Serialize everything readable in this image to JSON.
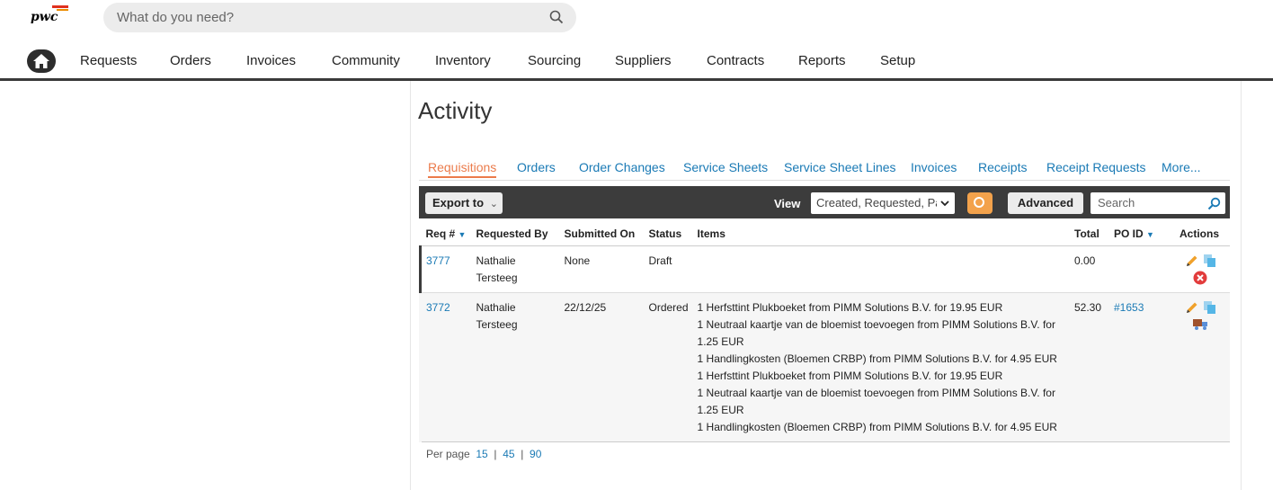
{
  "header": {
    "logo_text": "pwc",
    "search_placeholder": "What do you need?"
  },
  "nav": {
    "items": [
      "Requests",
      "Orders",
      "Invoices",
      "Community",
      "Inventory",
      "Sourcing",
      "Suppliers",
      "Contracts",
      "Reports",
      "Setup"
    ]
  },
  "page": {
    "title": "Activity"
  },
  "tabs": [
    "Requisitions",
    "Orders",
    "Order Changes",
    "Service Sheets",
    "Service Sheet Lines",
    "Invoices",
    "Receipts",
    "Receipt Requests",
    "More..."
  ],
  "toolbar": {
    "export_label": "Export to",
    "view_label": "View",
    "view_value": "Created, Requested, Pa",
    "advanced_label": "Advanced",
    "search_placeholder": "Search"
  },
  "table": {
    "headers": {
      "req": "Req #",
      "requested_by": "Requested By",
      "submitted_on": "Submitted On",
      "status": "Status",
      "items": "Items",
      "total": "Total",
      "po_id": "PO ID",
      "actions": "Actions"
    },
    "rows": [
      {
        "req": "3777",
        "requested_by": "Nathalie Tersteeg",
        "submitted_on": "None",
        "status": "Draft",
        "items": [],
        "total": "0.00",
        "po_id": ""
      },
      {
        "req": "3772",
        "requested_by": "Nathalie Tersteeg",
        "submitted_on": "22/12/25",
        "status": "Ordered",
        "items": [
          "1 Herfsttint Plukboeket from PIMM Solutions B.V. for 19.95 EUR",
          "1 Neutraal kaartje van de bloemist toevoegen from PIMM Solutions B.V. for 1.25 EUR",
          "1 Handlingkosten (Bloemen CRBP) from PIMM Solutions B.V. for 4.95 EUR",
          "1 Herfsttint Plukboeket from PIMM Solutions B.V. for 19.95 EUR",
          "1 Neutraal kaartje van de bloemist toevoegen from PIMM Solutions B.V. for 1.25 EUR",
          "1 Handlingkosten (Bloemen CRBP) from PIMM Solutions B.V. for 4.95 EUR"
        ],
        "total": "52.30",
        "po_id": "#1653"
      }
    ]
  },
  "pager": {
    "label": "Per page",
    "options": [
      "15",
      "45",
      "90"
    ],
    "separator": "|"
  },
  "colors": {
    "accent_orange": "#eb7b4b",
    "link_blue": "#1a7ab5",
    "toolbar_dark": "#3c3c3c"
  }
}
